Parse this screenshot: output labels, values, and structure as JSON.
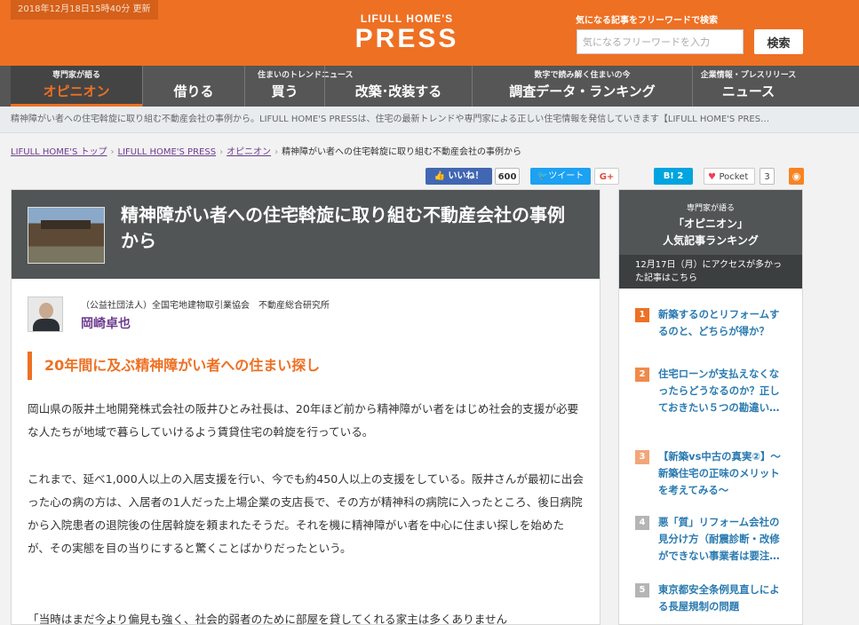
{
  "header": {
    "update_time": "2018年12月18日15時40分 更新",
    "logo_top": "LIFULL HOME'S",
    "logo_main": "PRESS",
    "search_caption": "気になる記事をフリーワードで検索",
    "search_placeholder": "気になるフリーワードを入力",
    "search_button": "検索",
    "accent_color": "#ee7023"
  },
  "nav": {
    "items": [
      {
        "caption": "専門家が語る",
        "label": "オピニオン",
        "active": true
      },
      {
        "caption": "",
        "label": "借りる"
      },
      {
        "caption": "住まいのトレンドニュース",
        "label": "買う"
      },
      {
        "caption": "",
        "label": "改築･改装する"
      },
      {
        "caption": "数字で読み解く住まいの今",
        "label": "調査データ・ランキング"
      },
      {
        "caption": "企業情報・プレスリリース",
        "label": "ニュース"
      }
    ]
  },
  "description": "精神障がい者への住宅斡旋に取り組む不動産会社の事例から。LIFULL HOME'S PRESSは、住宅の最新トレンドや専門家による正しい住宅情報を発信していきます【LIFULL HOME'S PRES…",
  "breadcrumb": {
    "items": [
      "LIFULL HOME'S トップ",
      "LIFULL HOME'S PRESS",
      "オピニオン"
    ],
    "current": "精神障がい者への住宅斡旋に取り組む不動産会社の事例から"
  },
  "social": {
    "like_label": "いいね！",
    "like_count": "600",
    "tweet_label": "ツイート",
    "gplus_label": "G+",
    "hatena_label": "B! 2",
    "pocket_label": "Pocket",
    "pocket_count": "3",
    "rss_icon": "rss-icon"
  },
  "article": {
    "title": "精神障がい者への住宅斡旋に取り組む不動産会社の事例から",
    "author_org": "（公益社団法人）全国宅地建物取引業協会　不動産総合研究所",
    "author_name": "岡崎卓也",
    "section_heading": "20年間に及ぶ精神障がい者への住まい探し",
    "paragraphs": [
      "岡山県の阪井土地開発株式会社の阪井ひとみ社長は、20年ほど前から精神障がい者をはじめ社会的支援が必要な人たちが地域で暮らしていけるよう賃貸住宅の斡旋を行っている。",
      "これまで、延べ1,000人以上の入居支援を行い、今でも約450人以上の支援をしている。阪井さんが最初に出会った心の病の方は、入居者の1人だった上場企業の支店長で、その方が精神科の病院に入ったところ、後日病院から入院患者の退院後の住居斡旋を頼まれたそうだ。それを機に精神障がい者を中心に住まい探しを始めたが、その実態を目の当りにすると驚くことばかりだったという。",
      "「当時はまだ今より偏見も強く、社会的弱者のために部屋を貸してくれる家主は多くありません"
    ]
  },
  "sidebar": {
    "caption": "専門家が語る",
    "title1": "「オピニオン」",
    "title2": "人気記事ランキング",
    "date_note": "12月17日（月）にアクセスが多かった記事はこちら",
    "ranking": [
      {
        "num": "1",
        "title": "新築するのとリフォームするのと、どちらが得か？",
        "color": "#ee7023"
      },
      {
        "num": "2",
        "title": "住宅ローンが支払えなくなったらどうなるのか？正しておきたい５つの勘違い…",
        "color": "#f08a4b"
      },
      {
        "num": "3",
        "title": "【新築vs中古の真実②】〜新築住宅の正味のメリットを考えてみる〜",
        "color": "#f3a57a"
      },
      {
        "num": "4",
        "title": "悪「質」リフォーム会社の見分け方（耐震診断・改修ができない事業者は要注…",
        "color": "#b5b5b5"
      },
      {
        "num": "5",
        "title": "東京都安全条例見直しによる長屋規制の問題",
        "color": "#b5b5b5"
      }
    ]
  }
}
